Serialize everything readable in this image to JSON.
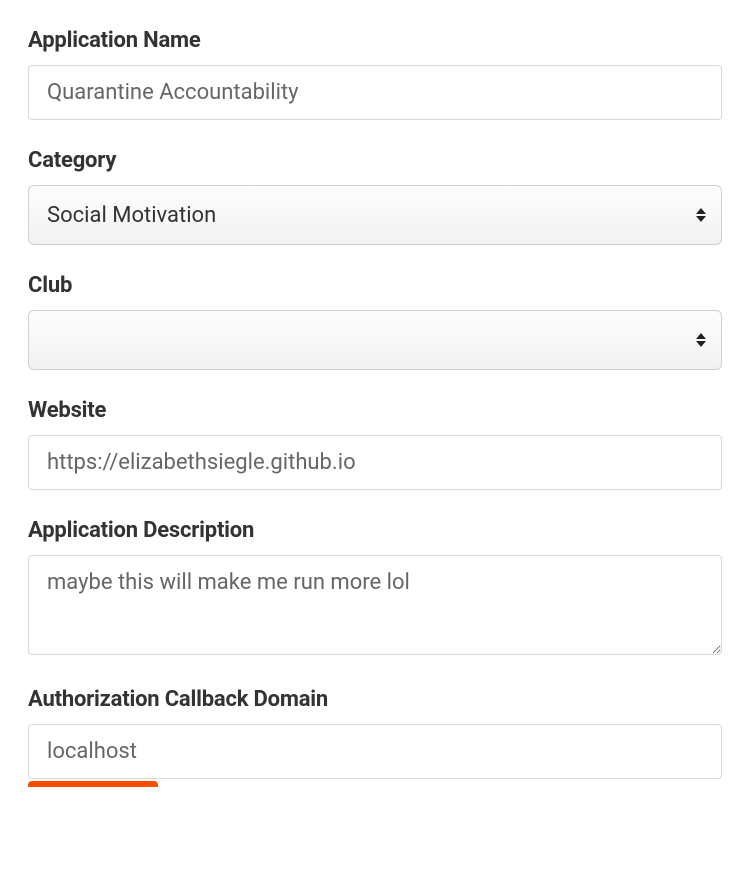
{
  "fields": {
    "application_name": {
      "label": "Application Name",
      "value": "Quarantine Accountability"
    },
    "category": {
      "label": "Category",
      "value": "Social Motivation"
    },
    "club": {
      "label": "Club",
      "value": ""
    },
    "website": {
      "label": "Website",
      "value": "https://elizabethsiegle.github.io"
    },
    "description": {
      "label": "Application Description",
      "value": "maybe this will make me run more lol"
    },
    "callback_domain": {
      "label": "Authorization Callback Domain",
      "value": "localhost"
    }
  }
}
